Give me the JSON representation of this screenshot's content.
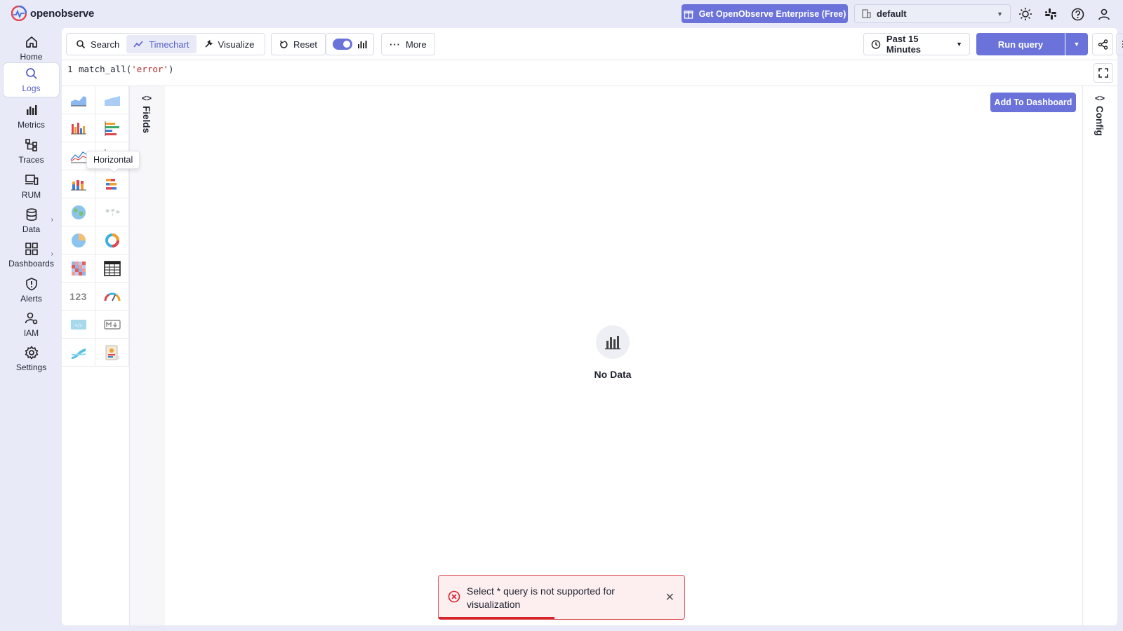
{
  "app": {
    "logo_text": "openobserve"
  },
  "topbar": {
    "enterprise_label": "Get OpenObserve Enterprise (Free)",
    "org_value": "default"
  },
  "nav": {
    "items": [
      {
        "label": "Home",
        "icon": "home-icon"
      },
      {
        "label": "Logs",
        "icon": "search-icon",
        "active": true
      },
      {
        "label": "Metrics",
        "icon": "bar-chart-icon"
      },
      {
        "label": "Traces",
        "icon": "tree-icon"
      },
      {
        "label": "RUM",
        "icon": "devices-icon"
      },
      {
        "label": "Data",
        "icon": "database-icon"
      },
      {
        "label": "Dashboards",
        "icon": "dashboard-icon"
      },
      {
        "label": "Alerts",
        "icon": "shield-alert-icon"
      },
      {
        "label": "IAM",
        "icon": "user-gear-icon"
      },
      {
        "label": "Settings",
        "icon": "gear-icon"
      }
    ]
  },
  "toolbar": {
    "search_label": "Search",
    "timechart_label": "Timechart",
    "visualize_label": "Visualize",
    "reset_label": "Reset",
    "more_label": "More",
    "time_range": "Past 15 Minutes",
    "run_label": "Run query"
  },
  "editor": {
    "line_number": "1",
    "code_fn": "match_all(",
    "code_str": "'error'",
    "code_end": ")"
  },
  "panel": {
    "tooltip": "Horizontal",
    "fields_label": "Fields",
    "config_label": "Config",
    "add_dashboard_label": "Add To Dashboard",
    "nodata_label": "No Data",
    "chart_types": [
      "area",
      "stacked-area",
      "bar",
      "horizontal-bar",
      "line",
      "scatter",
      "stacked-bar",
      "horizontal-stacked",
      "geomap",
      "maps",
      "pie",
      "donut",
      "heatmap",
      "table",
      "metric",
      "gauge",
      "html",
      "markdown",
      "sankey",
      "custom"
    ]
  },
  "toast": {
    "message": "Select * query is not supported for visualization",
    "progress": 0.47
  },
  "colors": {
    "accent": "#6b72d9",
    "error": "#d6242b",
    "bg": "#e8eaf8"
  }
}
